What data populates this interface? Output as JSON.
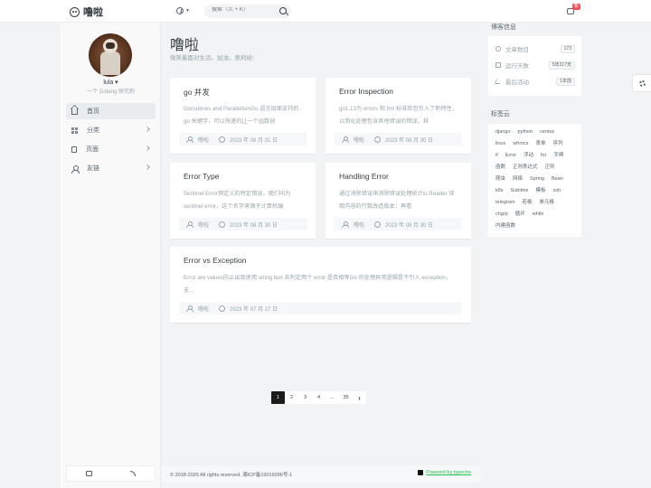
{
  "header": {
    "brand": "噜啦",
    "search_placeholder": "搜索（⌘ + K）",
    "notification_badge": "新"
  },
  "aside": {
    "user_name": "lula ▾",
    "user_desc": "一个 Golang 探究狗",
    "nav": [
      {
        "label": "首页",
        "icon": "home-icon"
      },
      {
        "label": "分类",
        "icon": "grid-icon"
      },
      {
        "label": "页面",
        "icon": "file-icon"
      },
      {
        "label": "友链",
        "icon": "user-icon"
      }
    ]
  },
  "main": {
    "title": "噜啦",
    "subtitle": "微笑着面对生活。加油，奥利给!",
    "posts": [
      {
        "title": "go 并发",
        "excerpt": "Goroutines and ParallelismGo 语言层面支持的go 关键字，可以快速的让一个函数创",
        "author": "噜啦",
        "date": "2023 年 08 月 31 日"
      },
      {
        "title": "Error Inspection",
        "excerpt": "go1.13为 errors 和 fmt 标准库包引入了新特性，以简化处理包含其他错误的错误。其",
        "author": "噜啦",
        "date": "2023 年 08 月 30 日"
      },
      {
        "title": "Error Type",
        "excerpt": "Sentinel Error预定义的特定错误，我们叫为sentinel error，这个名字来源于计算机编",
        "author": "噜啦",
        "date": "2023 年 08 月 30 日"
      },
      {
        "title": "Handling Error",
        "excerpt": "通过消除错误来消除错误处理统计io.Reader 读取内容的行数改造版本：再看",
        "author": "噜啦",
        "date": "2023 年 08 月 30 日"
      },
      {
        "title": "Error vs Exception",
        "excerpt": "Error are values防止出现使用 string text 去判定两个 error 是否相等Go 的处理异常逻辑是不引入 exception，支...",
        "author": "噜啦",
        "date": "2023 年 07 月 27 日"
      }
    ],
    "pagination": [
      "1",
      "2",
      "3",
      "4",
      "...",
      "35"
    ],
    "footer_copyright": "© 2018-2025 All rights reserved. 湘ICP备19016096号-1",
    "footer_powered": "Powered by typecho"
  },
  "right": {
    "blog_info_title": "博客信息",
    "stats": [
      {
        "label": "文章数目",
        "value": "173"
      },
      {
        "label": "运行天数",
        "value": "5年217天"
      },
      {
        "label": "最后活动",
        "value": "1年前"
      }
    ],
    "tags_title": "标签云",
    "tags": [
      "django",
      "python",
      "centos",
      "linux",
      "whmcs",
      "表单",
      "序列",
      "if",
      "Error",
      "浮动",
      "for",
      "字典",
      "函数",
      "正则表达式",
      "正则",
      "爬虫",
      "网络",
      "Spring",
      "Bean",
      "k8s",
      "Sublime",
      "模板",
      "ssh",
      "telegram",
      "若格",
      "单元格",
      "chgrp",
      "循环",
      "while",
      "内建函数"
    ]
  }
}
